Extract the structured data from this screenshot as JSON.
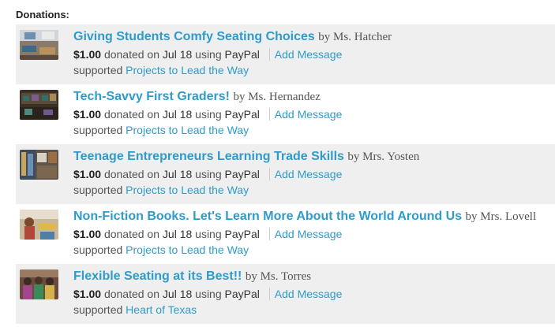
{
  "heading": "Donations:",
  "donations": [
    {
      "title": "Giving Students Comfy Seating Choices",
      "by": "by Ms. Hatcher",
      "amount": "$1.00",
      "donated_on_text": "donated on",
      "date": "Jul 18",
      "using_text": "using",
      "method": "PayPal",
      "message_label": "Add Message",
      "supported_text": "supported",
      "supported_link": "Projects to Lead the Way"
    },
    {
      "title": "Tech-Savvy First Graders!",
      "by": "by Ms. Hernandez",
      "amount": "$1.00",
      "donated_on_text": "donated on",
      "date": "Jul 18",
      "using_text": "using",
      "method": "PayPal",
      "message_label": "Add Message",
      "supported_text": "supported",
      "supported_link": "Projects to Lead the Way"
    },
    {
      "title": "Teenage Entrepreneurs Learning Trade Skills",
      "by": "by Mrs. Yosten",
      "amount": "$1.00",
      "donated_on_text": "donated on",
      "date": "Jul 18",
      "using_text": "using",
      "method": "PayPal",
      "message_label": "Add Message",
      "supported_text": "supported",
      "supported_link": "Projects to Lead the Way"
    },
    {
      "title": "Non-Fiction Books. Let's Learn More About the World Around Us",
      "by": "by Mrs. Lovell",
      "amount": "$1.00",
      "donated_on_text": "donated on",
      "date": "Jul 18",
      "using_text": "using",
      "method": "PayPal",
      "message_label": "Add Message",
      "supported_text": "supported",
      "supported_link": "Projects to Lead the Way"
    },
    {
      "title": "Flexible Seating at its Best!!",
      "by": "by Ms. Torres",
      "amount": "$1.00",
      "donated_on_text": "donated on",
      "date": "Jul 18",
      "using_text": "using",
      "method": "PayPal",
      "message_label": "Add Message",
      "supported_text": "supported",
      "supported_link": "Heart of Texas"
    }
  ],
  "colors": {
    "link": "#2e9bc9",
    "row_shade": "#efefef"
  }
}
